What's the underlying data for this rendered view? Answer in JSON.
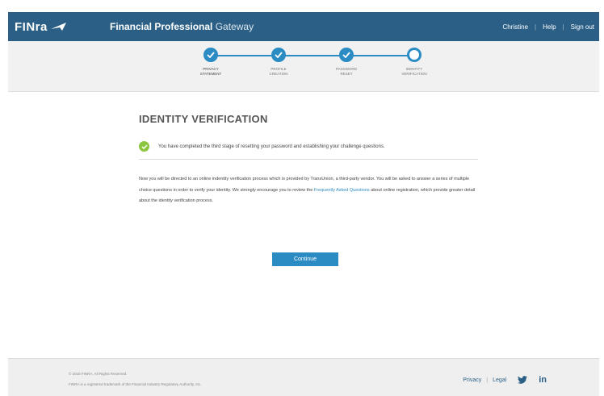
{
  "header": {
    "logo_text": "FINra",
    "title_bold": "Financial Professional",
    "title_light": "Gateway",
    "user_name": "Christine",
    "help_label": "Help",
    "signout_label": "Sign out",
    "separator": "|"
  },
  "progress": {
    "steps": [
      {
        "label_line1": "PRIVACY",
        "label_line2": "STATEMENT",
        "status": "complete"
      },
      {
        "label_line1": "PROFILE",
        "label_line2": "CREATION",
        "status": "complete"
      },
      {
        "label_line1": "PASSWORD",
        "label_line2": "RESET",
        "status": "complete"
      },
      {
        "label_line1": "IDENTITY",
        "label_line2": "VERIFICATION",
        "status": "current"
      }
    ]
  },
  "main": {
    "title": "IDENTITY VERIFICATION",
    "notice": "You have completed the third stage of resetting your password and establishing your challenge questions.",
    "body_part1": "Now you will be directed to an online indentity verification process which is provided by TransUnion, a third-party vendor. You will be asked to answer a series of multiple choice questions in order to verify your identity. We strongly encourage you to review the ",
    "body_link": "Frequently Asked Questions",
    "body_part2": " about online registration, which provide greater detail about the identity verification process.",
    "continue_label": "Continue"
  },
  "footer": {
    "copyright": "© 2016 FINRA. All Rights Reserved.",
    "trademark": "FINRA is a registered trademark of the Financial Industry Regulatory Authority, Inc.",
    "privacy_label": "Privacy",
    "legal_label": "Legal",
    "separator": "|",
    "linkedin_label": "in"
  },
  "colors": {
    "header_bg": "#2b5f86",
    "accent": "#2b8cc4",
    "success": "#8cc63f"
  }
}
